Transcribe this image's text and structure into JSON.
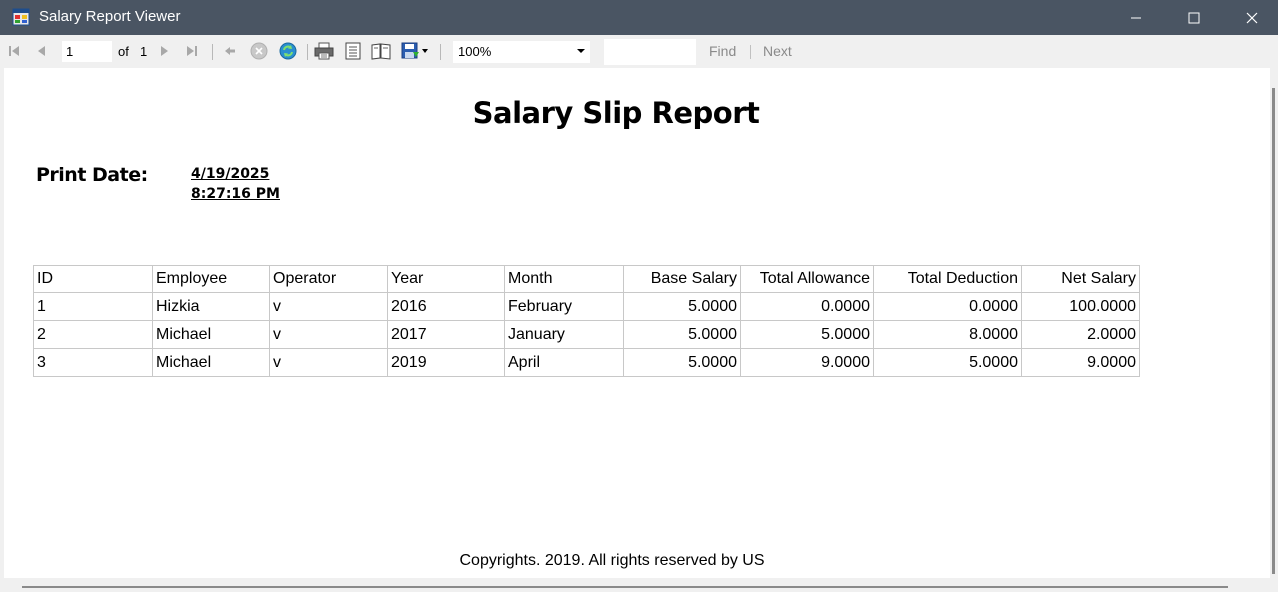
{
  "window": {
    "title": "Salary Report Viewer"
  },
  "toolbar": {
    "current_page": "1",
    "of_label": "of",
    "total_pages": "1",
    "zoom": "100%",
    "find_value": "",
    "find_label": "Find",
    "next_label": "Next"
  },
  "report": {
    "title": "Salary Slip Report",
    "print_date_label": "Print Date:",
    "print_date": "4/19/2025",
    "print_time": "8:27:16 PM",
    "columns": [
      "ID",
      "Employee",
      "Operator",
      "Year",
      "Month",
      "Base Salary",
      "Total Allowance",
      "Total Deduction",
      "Net Salary"
    ],
    "rows": [
      [
        "1",
        "Hizkia",
        "v",
        "2016",
        "February",
        "5.0000",
        "0.0000",
        "0.0000",
        "100.0000"
      ],
      [
        "2",
        "Michael",
        "v",
        "2017",
        "January",
        "5.0000",
        "5.0000",
        "8.0000",
        "2.0000"
      ],
      [
        "3",
        "Michael",
        "v",
        "2019",
        "April",
        "5.0000",
        "9.0000",
        "5.0000",
        "9.0000"
      ]
    ],
    "footer": "Copyrights. 2019. All rights reserved by US"
  }
}
